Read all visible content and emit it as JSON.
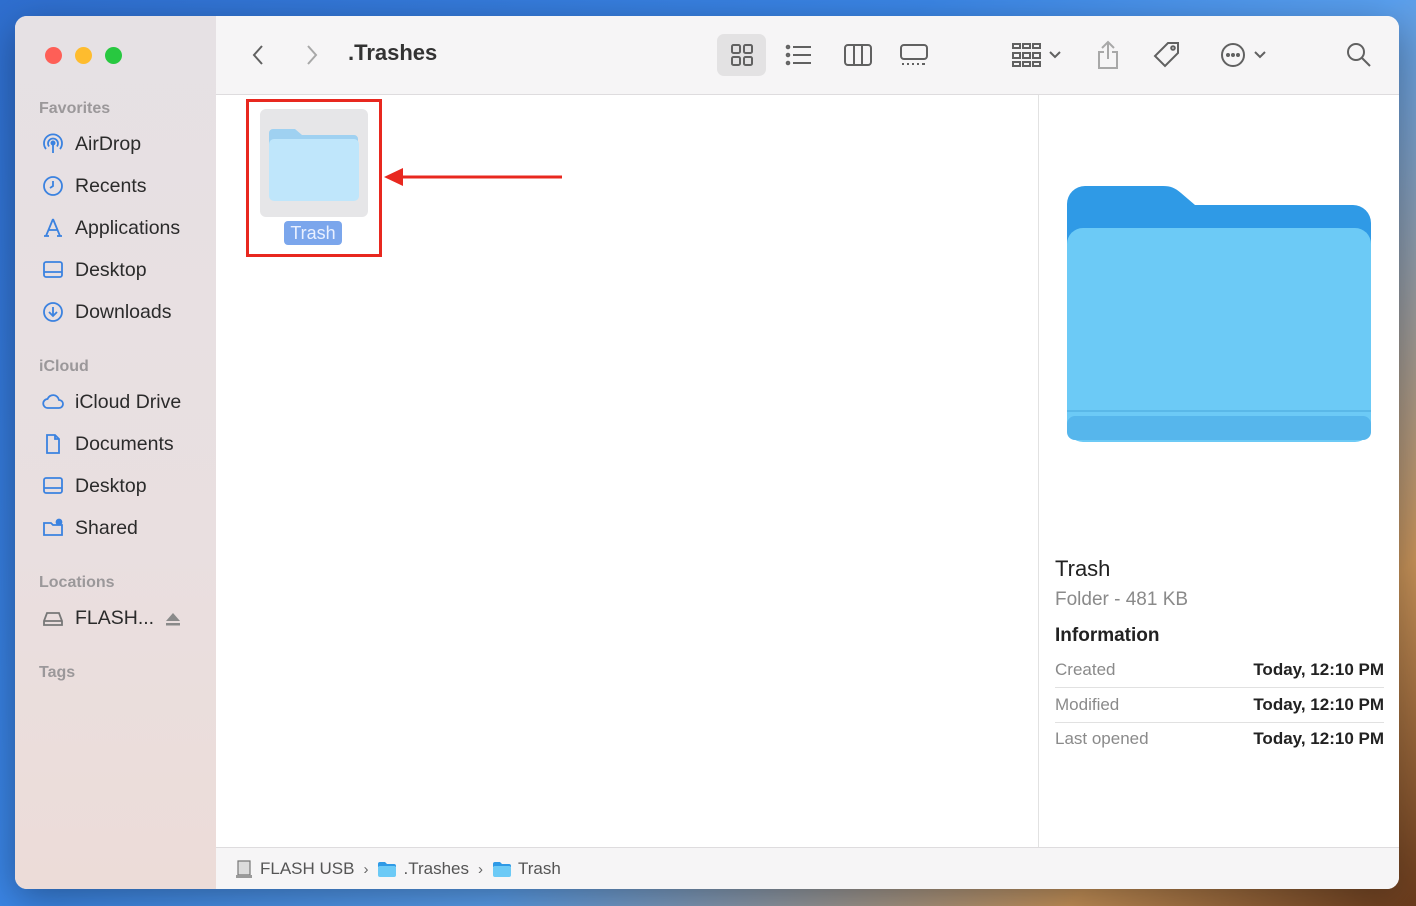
{
  "window": {
    "title": ".Trashes"
  },
  "sidebar": {
    "favorites_heading": "Favorites",
    "favorites": [
      {
        "label": "AirDrop",
        "icon": "airdrop-icon"
      },
      {
        "label": "Recents",
        "icon": "clock-icon"
      },
      {
        "label": "Applications",
        "icon": "applications-icon"
      },
      {
        "label": "Desktop",
        "icon": "desktop-icon"
      },
      {
        "label": "Downloads",
        "icon": "download-icon"
      }
    ],
    "icloud_heading": "iCloud",
    "icloud": [
      {
        "label": "iCloud Drive",
        "icon": "cloud-icon"
      },
      {
        "label": "Documents",
        "icon": "document-icon"
      },
      {
        "label": "Desktop",
        "icon": "desktop-icon"
      },
      {
        "label": "Shared",
        "icon": "shared-folder-icon"
      }
    ],
    "locations_heading": "Locations",
    "locations": [
      {
        "label": "FLASH...",
        "icon": "drive-icon"
      }
    ],
    "tags_heading": "Tags"
  },
  "content": {
    "items": [
      {
        "label": "Trash",
        "selected": true
      }
    ]
  },
  "preview": {
    "name": "Trash",
    "kind": "Folder - 481 KB",
    "info_heading": "Information",
    "rows": [
      {
        "key": "Created",
        "value": "Today, 12:10 PM"
      },
      {
        "key": "Modified",
        "value": "Today, 12:10 PM"
      },
      {
        "key": "Last opened",
        "value": "Today, 12:10 PM"
      }
    ]
  },
  "pathbar": {
    "segments": [
      "FLASH USB",
      ".Trashes",
      "Trash"
    ]
  },
  "colors": {
    "accent": "#7ba6ec",
    "folder": "#6ccaf6",
    "highlight": "#e8281f"
  }
}
